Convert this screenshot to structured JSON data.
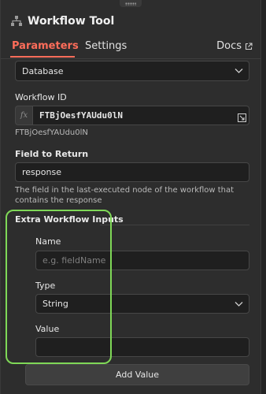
{
  "header": {
    "title": "Workflow Tool",
    "icon": "workflow-node-icon"
  },
  "tabs": [
    {
      "label": "Parameters",
      "active": true
    },
    {
      "label": "Settings",
      "active": false
    }
  ],
  "docs": {
    "label": "Docs",
    "icon": "external-link-icon"
  },
  "source": {
    "value": "Database"
  },
  "workflow_id": {
    "label": "Workflow ID",
    "fx_label": "fx",
    "value": "FTBjOesfYAUdu0lN",
    "preview": "FTBjOesfYAUdu0lN"
  },
  "field_to_return": {
    "label": "Field to Return",
    "value": "response",
    "hint": "The field in the last-executed node of the workflow that contains the response"
  },
  "extra_inputs": {
    "title": "Extra Workflow Inputs",
    "name_label": "Name",
    "name_placeholder": "e.g. fieldName",
    "type_label": "Type",
    "type_value": "String",
    "value_label": "Value",
    "value_value": "",
    "add_button": "Add Value"
  },
  "colors": {
    "accent": "#ff6d5a",
    "highlight": "#7fd857",
    "panel_bg": "#2d2d2d",
    "input_bg": "#1f1f1f"
  }
}
